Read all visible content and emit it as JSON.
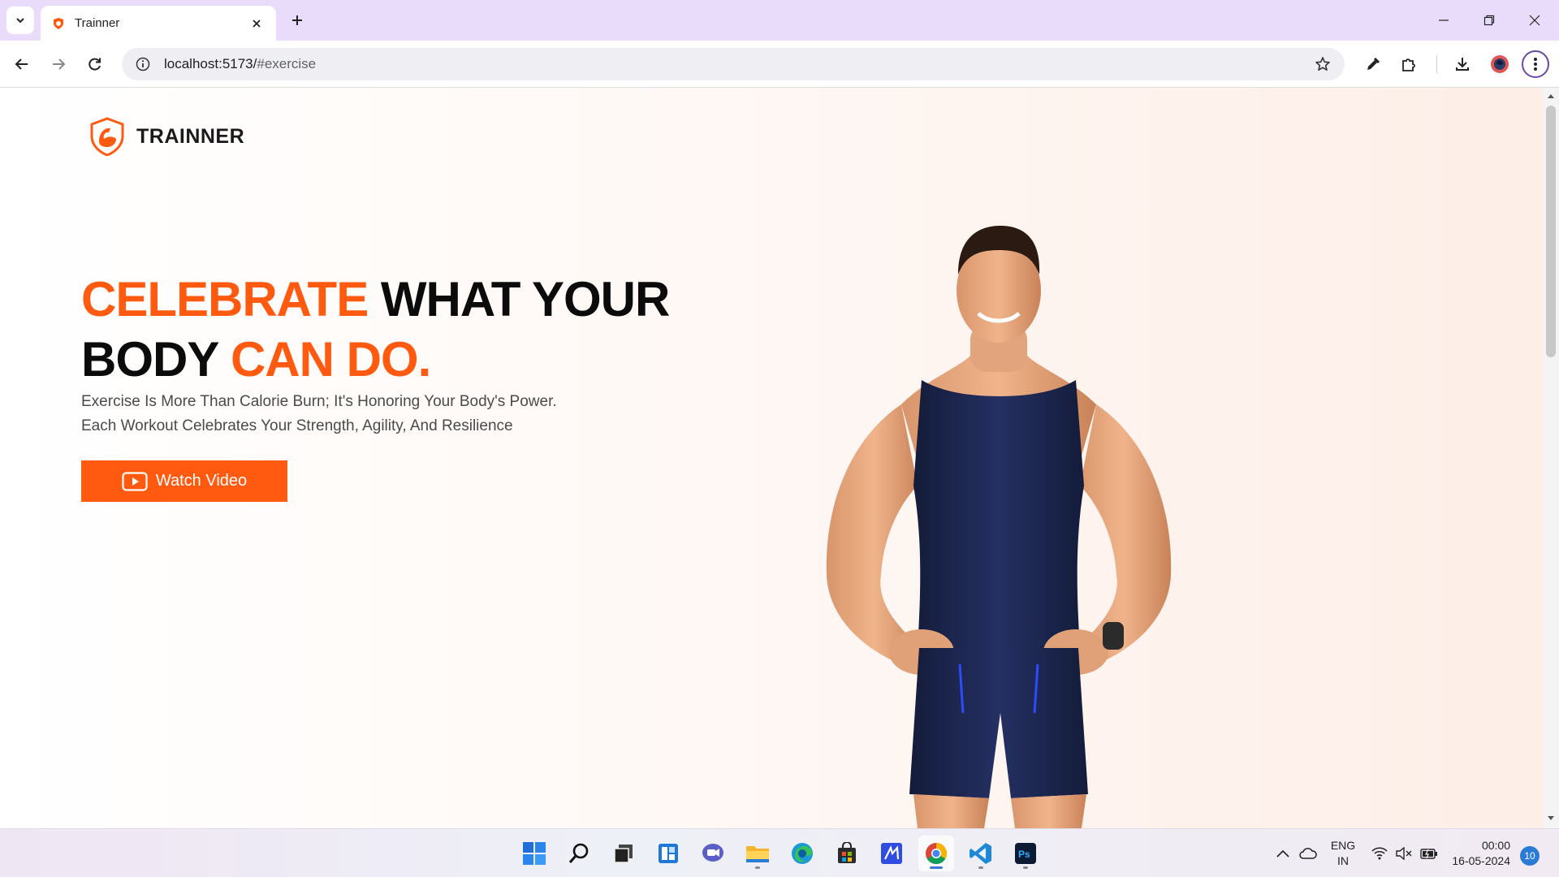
{
  "browser": {
    "tab_title": "Trainner",
    "url_host": "localhost:5173/",
    "url_path": "#exercise"
  },
  "page": {
    "brand": "TRAINNER",
    "headline": {
      "part1_accent": "CELEBRATE",
      "part2": " WHAT YOUR",
      "part3": "BODY ",
      "part4_accent": "CAN DO."
    },
    "subtext_line1": "Exercise Is More Than Calorie Burn; It's Honoring Your Body's Power.",
    "subtext_line2": "Each Workout Celebrates Your Strength, Agility, And Resilience",
    "cta_label": "Watch Video",
    "colors": {
      "accent": "#ff5a0f",
      "headline": "#0b0b0b"
    }
  },
  "taskbar": {
    "apps": [
      "start-icon",
      "search-icon",
      "task-view-icon",
      "widgets-icon",
      "chat-icon",
      "file-explorer-icon",
      "edge-icon",
      "store-icon",
      "code-editor-icon",
      "chrome-icon",
      "vscode-icon",
      "photoshop-icon"
    ],
    "lang_line1": "ENG",
    "lang_line2": "IN",
    "time": "00:00",
    "date": "16-05-2024",
    "notification_count": "10"
  }
}
